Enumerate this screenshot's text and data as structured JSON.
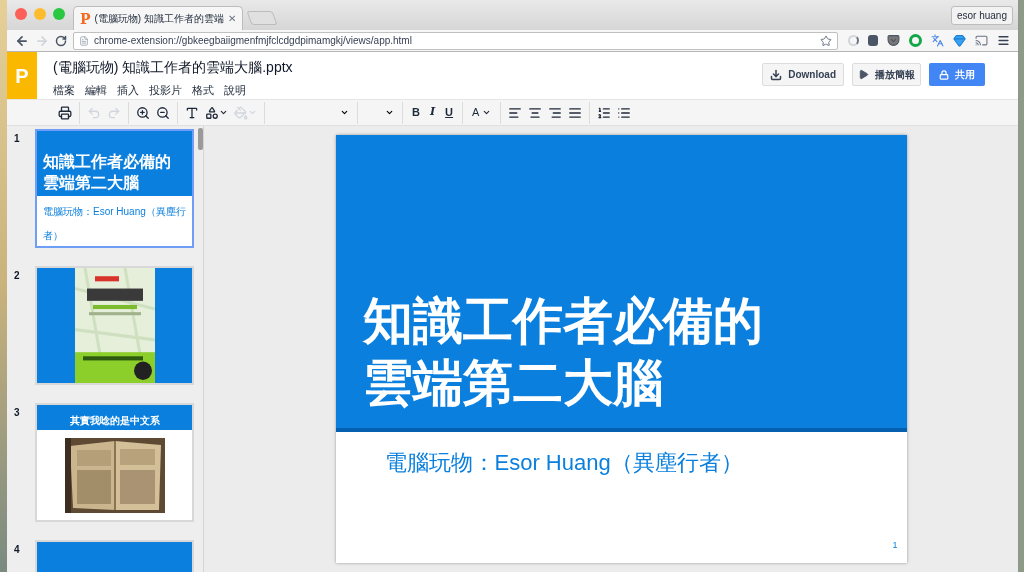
{
  "browser": {
    "tab_logo": "P",
    "tab_title": "(電腦玩物) 知識工作者的雲端",
    "tab_close": "✕",
    "url": "chrome-extension://gbkeegbaiigmenfmjfclcdgdpimamgkj/views/app.html",
    "profile": "esor huang"
  },
  "app": {
    "logo": "P",
    "title": "(電腦玩物) 知識工作者的雲端大腦.pptx",
    "menus": [
      "檔案",
      "編輯",
      "插入",
      "投影片",
      "格式",
      "說明"
    ],
    "buttons": [
      {
        "kind": "download",
        "label": "Download"
      },
      {
        "kind": "present",
        "label": "播放簡報"
      },
      {
        "kind": "share",
        "label": "共用"
      }
    ]
  },
  "toolbar": [
    [
      {
        "kind": "icon",
        "disabled": false
      }
    ],
    [
      {
        "kind": "icon",
        "disabled": true
      },
      {
        "kind": "icon",
        "disabled": true
      }
    ],
    [
      {
        "kind": "icon",
        "disabled": false
      },
      {
        "kind": "icon",
        "disabled": false
      }
    ],
    [
      {
        "kind": "icon",
        "disabled": false
      },
      {
        "kind": "icon",
        "disabled": false
      },
      {
        "kind": "icon",
        "disabled": true
      }
    ],
    [
      {
        "kind": "dropdown"
      }
    ],
    [
      {
        "kind": "dropdown"
      }
    ],
    [
      {
        "kind": "text",
        "label": "B"
      },
      {
        "kind": "text",
        "label": "I"
      },
      {
        "kind": "text",
        "label": "U"
      }
    ],
    [
      {
        "kind": "text",
        "label": "A"
      }
    ],
    [
      {
        "kind": "icon",
        "disabled": false
      },
      {
        "kind": "icon",
        "disabled": false
      },
      {
        "kind": "icon",
        "disabled": false
      },
      {
        "kind": "icon",
        "disabled": false
      }
    ],
    [
      {
        "kind": "icon",
        "disabled": false
      },
      {
        "kind": "icon",
        "disabled": false
      }
    ]
  ],
  "slides": [
    {
      "number": "1",
      "selected": true,
      "kind": "title",
      "title": [
        "知識工作者必備的",
        "雲端第二大腦"
      ],
      "subtitle": "電腦玩物：Esor Huang（異塵行者）"
    },
    {
      "number": "2",
      "selected": false,
      "kind": "picture"
    },
    {
      "number": "3",
      "selected": false,
      "kind": "heading-picture",
      "title": [
        "其實我唸的是中文系"
      ]
    },
    {
      "number": "4",
      "selected": false,
      "kind": "blank"
    }
  ],
  "current_slide": {
    "title": [
      "知識工作者必備的",
      "雲端第二大腦"
    ],
    "subtitle": "電腦玩物：Esor Huang（異塵行者）",
    "page_number": "1"
  }
}
